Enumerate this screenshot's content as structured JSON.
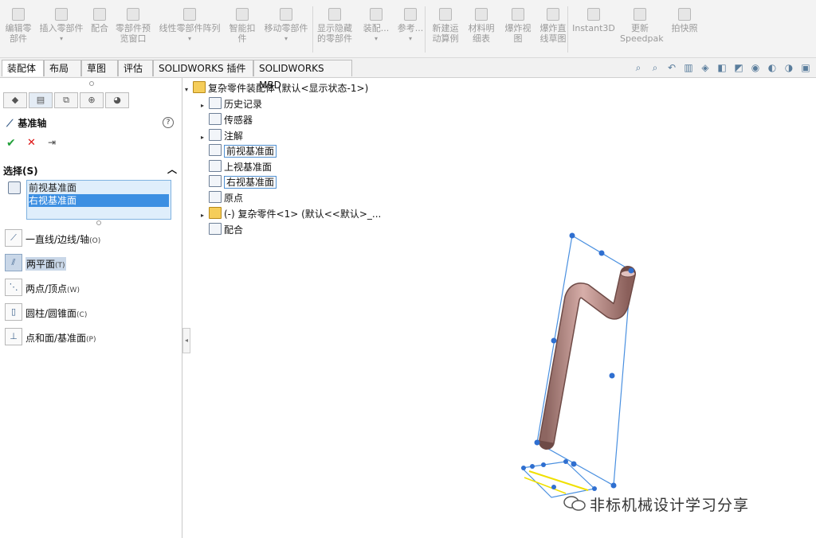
{
  "ribbon": [
    {
      "label": "编辑零\n部件"
    },
    {
      "label": "插入零部件",
      "arrow": true
    },
    {
      "label": "配合"
    },
    {
      "label": "零部件预\n览窗口"
    },
    {
      "label": "线性零部件阵列",
      "arrow": true
    },
    {
      "label": "智能扣\n件"
    },
    {
      "label": "移动零部件",
      "arrow": true
    },
    {
      "label": "显示隐藏\n的零部件"
    },
    {
      "label": "装配...",
      "arrow": true
    },
    {
      "label": "参考...",
      "arrow": true
    },
    {
      "label": "新建运\n动算例"
    },
    {
      "label": "材料明\n细表"
    },
    {
      "label": "爆炸视\n图"
    },
    {
      "label": "爆炸直\n线草图"
    },
    {
      "label": "Instant3D"
    },
    {
      "label": "更新\nSpeedpak"
    },
    {
      "label": "拍快照"
    }
  ],
  "tabs": [
    "装配体",
    "布局",
    "草图",
    "评估",
    "SOLIDWORKS 插件",
    "SOLIDWORKS MBD"
  ],
  "panel": {
    "title": "基准轴",
    "help": "?",
    "ok": "✔",
    "cancel": "✕",
    "pin": "⇥",
    "section": "选择(S)",
    "selections": [
      "前视基准面",
      "右视基准面"
    ],
    "options": [
      {
        "label": "一直线/边线/轴",
        "key": "(O)"
      },
      {
        "label": "两平面",
        "key": "(T)",
        "selected": true
      },
      {
        "label": "两点/顶点",
        "key": "(W)"
      },
      {
        "label": "圆柱/圆锥面",
        "key": "(C)"
      },
      {
        "label": "点和面/基准面",
        "key": "(P)"
      }
    ]
  },
  "tree": [
    {
      "label": "复杂零件装配体 (默认<显示状态-1>)",
      "expanded": true
    },
    {
      "label": "历史记录",
      "twisty": true
    },
    {
      "label": "传感器"
    },
    {
      "label": "注解",
      "twisty": true
    },
    {
      "label": "前视基准面",
      "boxed": true
    },
    {
      "label": "上视基准面"
    },
    {
      "label": "右视基准面",
      "boxed": true
    },
    {
      "label": "原点"
    },
    {
      "label": "(-) 复杂零件<1> (默认<<默认>_...",
      "twisty": true
    },
    {
      "label": "配合"
    }
  ],
  "watermark": "非标机械设计学习分享",
  "colors": {
    "selection": "#3c8fe2",
    "part": "#b98a86",
    "plane": "#4a90e0",
    "highlight_line": "#f0e000"
  }
}
